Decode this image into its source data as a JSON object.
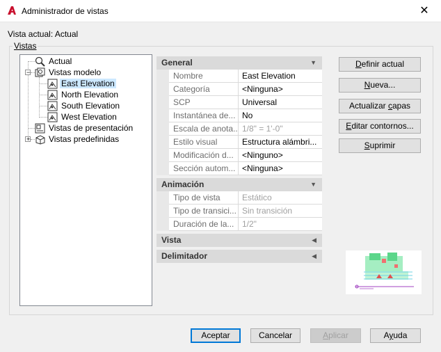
{
  "window": {
    "title": "Administrador de vistas",
    "close_glyph": "✕",
    "app_icon": "autocad-a-icon"
  },
  "current_view_label": "Vista actual: Actual",
  "group_title": "Vistas",
  "tree": {
    "items": [
      {
        "label": "Actual",
        "icon": "magnifier-icon"
      },
      {
        "label": "Vistas modelo",
        "icon": "model-views-icon",
        "expander": "−"
      },
      {
        "label": "East Elevation",
        "icon": "named-view-icon",
        "selected": true
      },
      {
        "label": "North Elevation",
        "icon": "named-view-icon"
      },
      {
        "label": "South Elevation",
        "icon": "named-view-icon"
      },
      {
        "label": "West Elevation",
        "icon": "named-view-icon"
      },
      {
        "label": "Vistas de presentación",
        "icon": "layout-views-icon"
      },
      {
        "label": "Vistas predefinidas",
        "icon": "preset-views-icon",
        "expander": "+"
      }
    ]
  },
  "sections": {
    "general": {
      "title": "General",
      "arrow": "▼",
      "rows": [
        {
          "name": "Nombre",
          "value": "East Elevation"
        },
        {
          "name": "Categoría",
          "value": "<Ninguna>"
        },
        {
          "name": "SCP",
          "value": "Universal"
        },
        {
          "name": "Instantánea de...",
          "value": "No"
        },
        {
          "name": "Escala de anota...",
          "value": "1/8\" = 1'-0\"",
          "disabled": true
        },
        {
          "name": "Estilo visual",
          "value": "Estructura alámbri..."
        },
        {
          "name": "Modificación d...",
          "value": "<Ninguno>"
        },
        {
          "name": "Sección autom...",
          "value": "<Ninguna>"
        }
      ]
    },
    "animacion": {
      "title": "Animación",
      "arrow": "▼",
      "rows": [
        {
          "name": "Tipo de vista",
          "value": "Estático",
          "disabled": true
        },
        {
          "name": "Tipo de transici...",
          "value": "Sin transición",
          "disabled": true
        },
        {
          "name": "Duración de la...",
          "value": "1/2\"",
          "disabled": true
        }
      ]
    },
    "vista": {
      "title": "Vista",
      "arrow": "◀"
    },
    "delimitador": {
      "title": "Delimitador",
      "arrow": "◀"
    }
  },
  "buttons": {
    "definir_actual": {
      "pre": "",
      "key": "D",
      "post": "efinir actual"
    },
    "nueva": {
      "pre": "",
      "key": "N",
      "post": "ueva..."
    },
    "actualizar_capas": {
      "pre": "Actualizar ",
      "key": "c",
      "post": "apas"
    },
    "editar_contornos": {
      "pre": "",
      "key": "E",
      "post": "ditar contornos..."
    },
    "suprimir": {
      "pre": "",
      "key": "S",
      "post": "uprimir"
    }
  },
  "footer": {
    "aceptar": "Aceptar",
    "cancelar": "Cancelar",
    "aplicar": {
      "pre": "",
      "key": "A",
      "post": "plicar"
    },
    "ayuda": {
      "pre": "A",
      "key": "y",
      "post": "uda"
    }
  },
  "colors": {
    "selection": "#cce8ff",
    "default_button_border": "#0078d7",
    "section_header": "#dadada",
    "brand_red": "#c8102e"
  }
}
